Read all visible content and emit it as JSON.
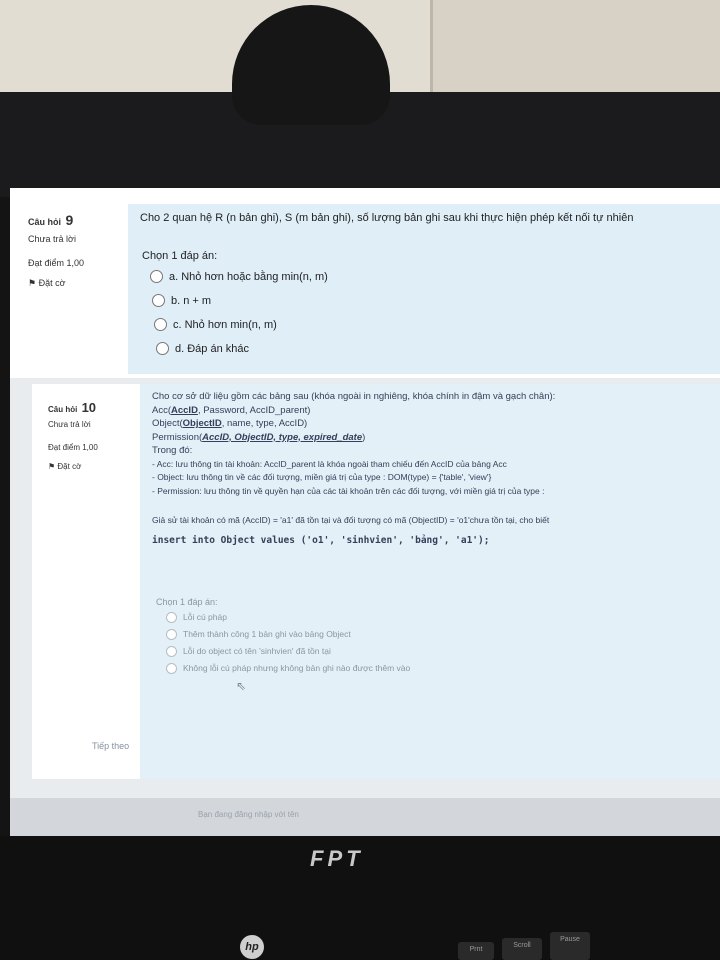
{
  "question9": {
    "number_prefix": "Câu hỏi",
    "number": "9",
    "status": "Chưa trả lời",
    "score": "Đạt điểm 1,00",
    "flag": "Đặt cờ",
    "text": "Cho 2 quan hệ R (n bản ghi), S (m bản ghi), số lượng bản ghi sau khi thực hiện phép kết nối tự nhiên",
    "prompt": "Chọn 1 đáp án:",
    "options": [
      "a. Nhỏ hơn hoặc bằng min(n, m)",
      "b. n + m",
      "c. Nhỏ hơn min(n, m)",
      "d. Đáp án khác"
    ]
  },
  "question10": {
    "number_prefix": "Câu hỏi",
    "number": "10",
    "status": "Chưa trả lời",
    "score": "Đạt điểm 1,00",
    "flag": "Đặt cờ",
    "intro": "Cho cơ sở dữ liệu gồm các bảng sau (khóa ngoài in nghiêng, khóa chính in đậm và gạch chân):",
    "acc_name": "Acc(",
    "acc_key": "AccID",
    "acc_rest": ", Password, AccID_parent)",
    "object_name": "Object(",
    "object_key": "ObjectID",
    "object_rest": ", name, type, AccID)",
    "perm_name": "Permission(",
    "perm_key": "AccID, ObjectID, type, expired_date",
    "perm_rest": ")",
    "where": "Trong đó:",
    "notes": [
      "- Acc: lưu thông tin tài khoản: AccID_parent là khóa ngoài tham chiếu đến AccID của bảng Acc",
      "- Object: lưu thông tin về các đối tượng, miền giá trị của type : DOM(type) = {'table', 'view'}",
      "- Permission: lưu thông tin về quyền hạn của các tài khoản trên các đối tượng, với miền giá trị của type :"
    ],
    "assumption": "Giả sử tài khoản có mã (AccID) = 'a1' đã tồn tại và đối tượng có mã (ObjectID) = 'o1'chưa tồn tại, cho biết",
    "sql": "insert into Object values ('o1', 'sinhvien', 'bảng', 'a1');",
    "prompt": "Chọn 1 đáp án:",
    "options": [
      "Lỗi cú pháp",
      "Thêm thành công 1 bản ghi vào bảng Object",
      "Lỗi do object có tên 'sinhvien' đã tồn tại",
      "Không lỗi cú pháp nhưng không bản ghi nào được thêm vào"
    ]
  },
  "nav": {
    "next": "Tiếp theo"
  },
  "footer": {
    "login_note": "Bạn đang đăng nhập với tên"
  },
  "monitor": {
    "brand": "FPT",
    "laptop_logo": "hp"
  },
  "keys": [
    "Prnt",
    "Scroll",
    "Pause"
  ]
}
